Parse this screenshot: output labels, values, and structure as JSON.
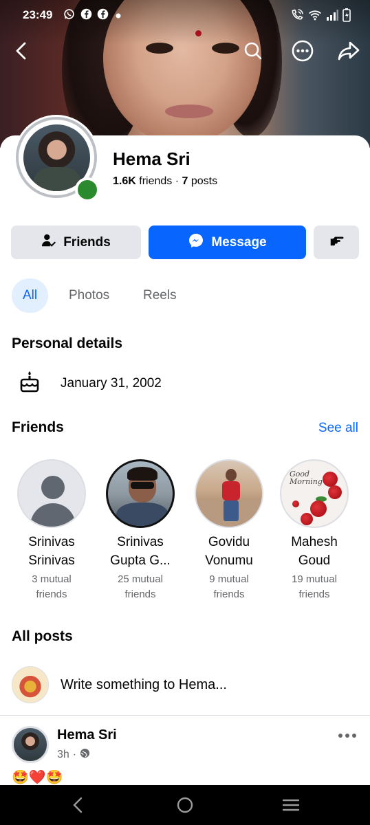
{
  "status_bar": {
    "time": "23:49",
    "left_icons": [
      "whatsapp-icon",
      "facebook-icon",
      "facebook-icon",
      "dot-icon"
    ],
    "right_icons": [
      "call-wifi-icon",
      "wifi-icon",
      "signal-icon",
      "battery-charging-icon"
    ]
  },
  "top_nav": {
    "icons": [
      "back-icon",
      "search-icon",
      "more-circle-icon",
      "share-icon"
    ]
  },
  "profile": {
    "name": "Hema Sri",
    "friends_count": "1.6K",
    "friends_label": "friends",
    "separator": "·",
    "posts_count": "7",
    "posts_label": "posts",
    "online": true
  },
  "actions": {
    "friends_label": "Friends",
    "message_label": "Message",
    "accent": "#0866ff"
  },
  "tabs": [
    {
      "label": "All",
      "active": true
    },
    {
      "label": "Photos",
      "active": false
    },
    {
      "label": "Reels",
      "active": false
    }
  ],
  "personal_details": {
    "title": "Personal details",
    "birthday": "January 31, 2002"
  },
  "friends_section": {
    "title": "Friends",
    "see_all": "See all",
    "items": [
      {
        "name_line1": "Srinivas",
        "name_line2": "Srinivas",
        "mutual_line1": "3 mutual",
        "mutual_line2": "friends"
      },
      {
        "name_line1": "Srinivas",
        "name_line2": "Gupta G...",
        "mutual_line1": "25 mutual",
        "mutual_line2": "friends"
      },
      {
        "name_line1": "Govidu",
        "name_line2": "Vonumu",
        "mutual_line1": "9 mutual",
        "mutual_line2": "friends"
      },
      {
        "name_line1": "Mahesh",
        "name_line2": "Goud",
        "mutual_line1": "19 mutual",
        "mutual_line2": "friends",
        "photo_text_1": "Good",
        "photo_text_2": "Morning"
      }
    ]
  },
  "posts": {
    "title": "All posts",
    "composer_prompt": "Write something to Hema...",
    "post": {
      "author": "Hema Sri",
      "time": "3h",
      "separator": "·",
      "privacy_icon": "globe-icon",
      "text": "🤩❤️🤩"
    }
  },
  "android_nav": {
    "icons": [
      "back-nav-icon",
      "home-nav-icon",
      "recents-nav-icon"
    ]
  }
}
